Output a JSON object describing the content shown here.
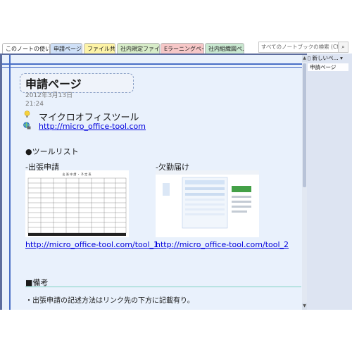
{
  "tabs": [
    {
      "label": "このノートの使い方",
      "color": "#ffffff"
    },
    {
      "label": "申請ページ",
      "color": "#cfe0f7"
    },
    {
      "label": "ファイル共有",
      "color": "#fdf3a6"
    },
    {
      "label": "社内規定ファイル",
      "color": "#d7ecc8"
    },
    {
      "label": "Eラーニングページ",
      "color": "#f6c7c7"
    },
    {
      "label": "社内組織図ペ...",
      "color": "#c9e8d0"
    }
  ],
  "search": {
    "placeholder": "すべてのノートブックの検索 (Ctrl+E)",
    "icon": "search-icon"
  },
  "page": {
    "title": "申請ページ",
    "date": "2012年3月13日",
    "time": "21:24",
    "app_name": "マイクロオフィスツール",
    "main_link": "http://micro_office-tool.com",
    "tool_list_heading": "●ツールリスト",
    "tool1_label": "-出張申請",
    "tool2_label": "-欠勤届け",
    "tool1_link": "http://micro_office-tool.com/tool_1",
    "tool2_link": "http://micro_office-tool.com/tool_2",
    "tool1_doc_title": "出 張 申 請 ・ 予 定 表",
    "notes_heading": "■備考",
    "notes_text": "・出張申請の記述方法はリンク先の下方に記載有り。"
  },
  "sidebar": {
    "new_page": "新しいペ...",
    "items": [
      {
        "label": "申請ページ"
      }
    ]
  },
  "colors": {
    "accent": "#4a6fc6",
    "link": "#0000dd",
    "page_bg": "#e9f1fc",
    "frame": "#5d6d9e"
  }
}
